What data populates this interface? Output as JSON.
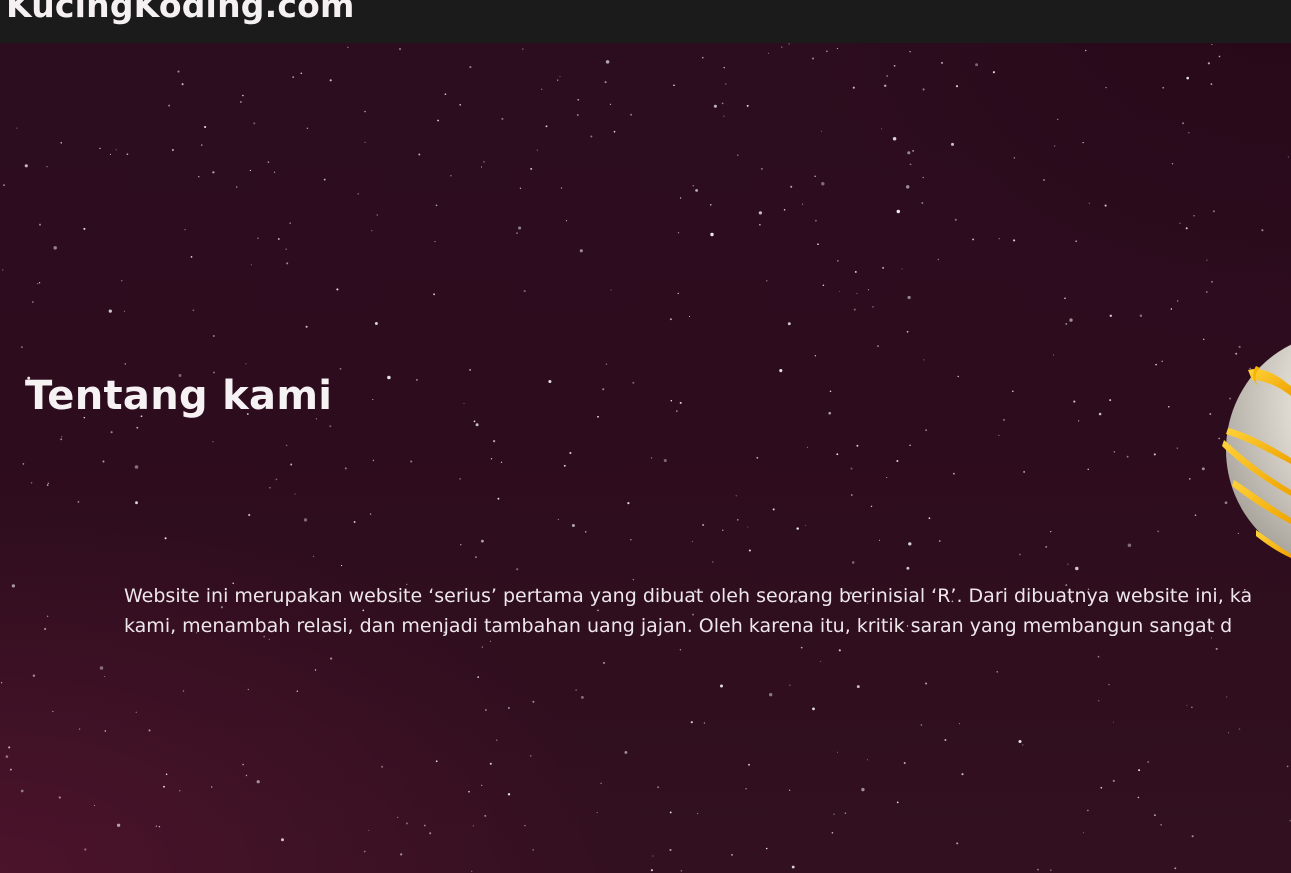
{
  "header": {
    "site_name": "KucingKoding.com"
  },
  "about": {
    "title": "Tentang kami",
    "body_line_1": "Website ini merupakan website ‘serius’ pertama yang dibuat oleh seorang berinisial ‘R’. Dari dibuatnya website ini, ka",
    "body_line_2": "kami, menambah relasi, dan menjadi tambahan uang jajan. Oleh karena itu, kritik saran yang membangun sangat d"
  },
  "decor": {
    "illustration_icon": "planet-icon"
  },
  "colors": {
    "header_bg": "#1c1b1c",
    "page_bg": "#2d0c1e",
    "accent_gold": "#f5b400",
    "text": "#f6f2f3"
  }
}
